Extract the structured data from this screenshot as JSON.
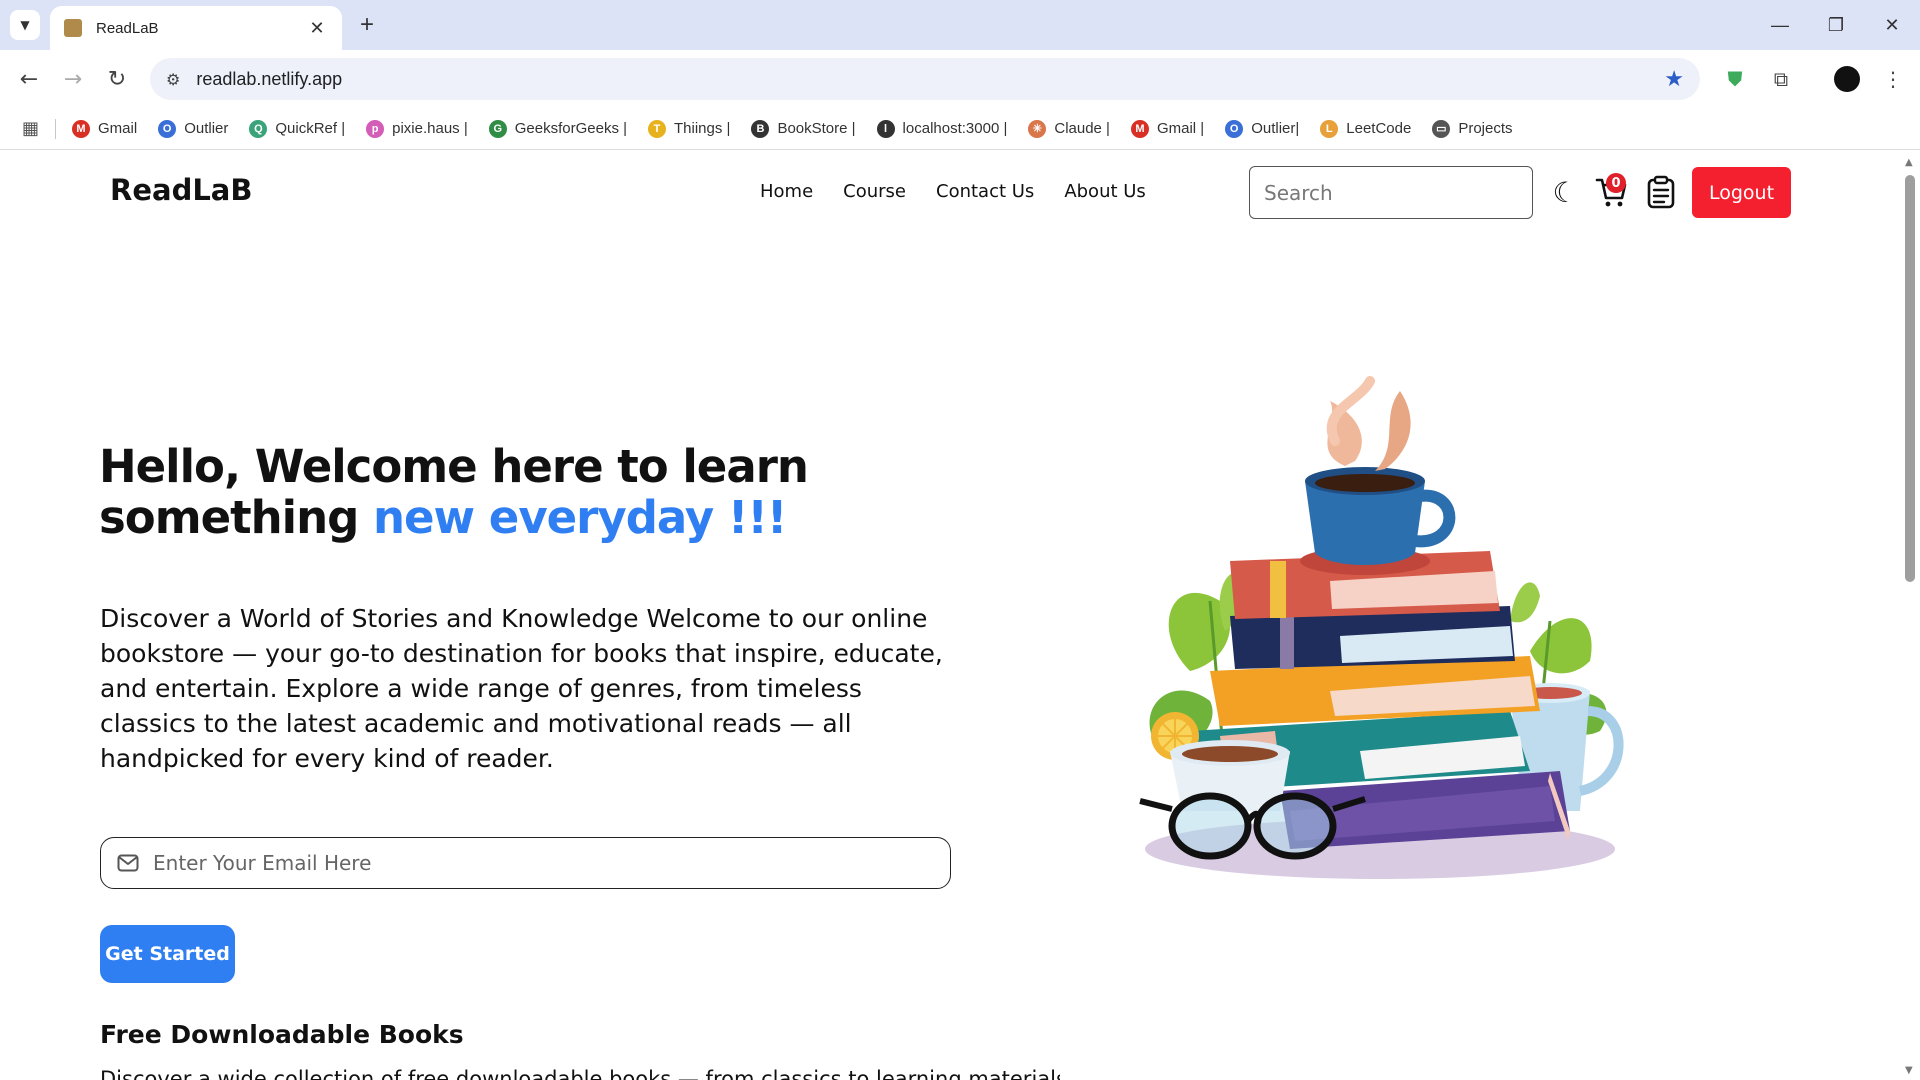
{
  "browser": {
    "tab_title": "ReadLaB",
    "url": "readlab.netlify.app",
    "bookmarks": [
      {
        "label": "Gmail",
        "color": "#d93025",
        "glyph": "M"
      },
      {
        "label": "Outlier",
        "color": "#3b6fd8",
        "glyph": "O"
      },
      {
        "label": "QuickRef |",
        "color": "#3aa37a",
        "glyph": "Q"
      },
      {
        "label": "pixie.haus |",
        "color": "#d45db8",
        "glyph": "p"
      },
      {
        "label": "GeeksforGeeks |",
        "color": "#2f8d46",
        "glyph": "G"
      },
      {
        "label": "Thiings |",
        "color": "#e8b21e",
        "glyph": "T"
      },
      {
        "label": "BookStore |",
        "color": "#333333",
        "glyph": "B"
      },
      {
        "label": "localhost:3000 |",
        "color": "#333333",
        "glyph": "l"
      },
      {
        "label": "Claude |",
        "color": "#d9774b",
        "glyph": "✳"
      },
      {
        "label": "Gmail |",
        "color": "#d93025",
        "glyph": "M"
      },
      {
        "label": "Outlier|",
        "color": "#3b6fd8",
        "glyph": "O"
      },
      {
        "label": "LeetCode",
        "color": "#e8a03a",
        "glyph": "L"
      },
      {
        "label": "Projects",
        "color": "#555555",
        "glyph": "▭"
      }
    ]
  },
  "site": {
    "brand": "ReadLaB",
    "nav": [
      "Home",
      "Course",
      "Contact Us",
      "About Us"
    ],
    "search_placeholder": "Search",
    "cart_count": "0",
    "logout_label": "Logout"
  },
  "hero": {
    "title_part1": "Hello, Welcome here to learn something ",
    "title_accent": "new everyday !!!",
    "description": "Discover a World of Stories and Knowledge Welcome to our online bookstore — your go-to destination for books that inspire, educate, and entertain. Explore a wide range of genres, from timeless classics to the latest academic and motivational reads — all handpicked for every kind of reader.",
    "email_placeholder": "Enter Your Email Here",
    "cta_label": "Get Started"
  },
  "free_books": {
    "title": "Free Downloadable Books",
    "text": "Discover a wide collection of free downloadable books — from classics to learning materials"
  },
  "colors": {
    "accent": "#2f7ff2",
    "logout": "#f5202f",
    "badge": "#e0202a"
  }
}
